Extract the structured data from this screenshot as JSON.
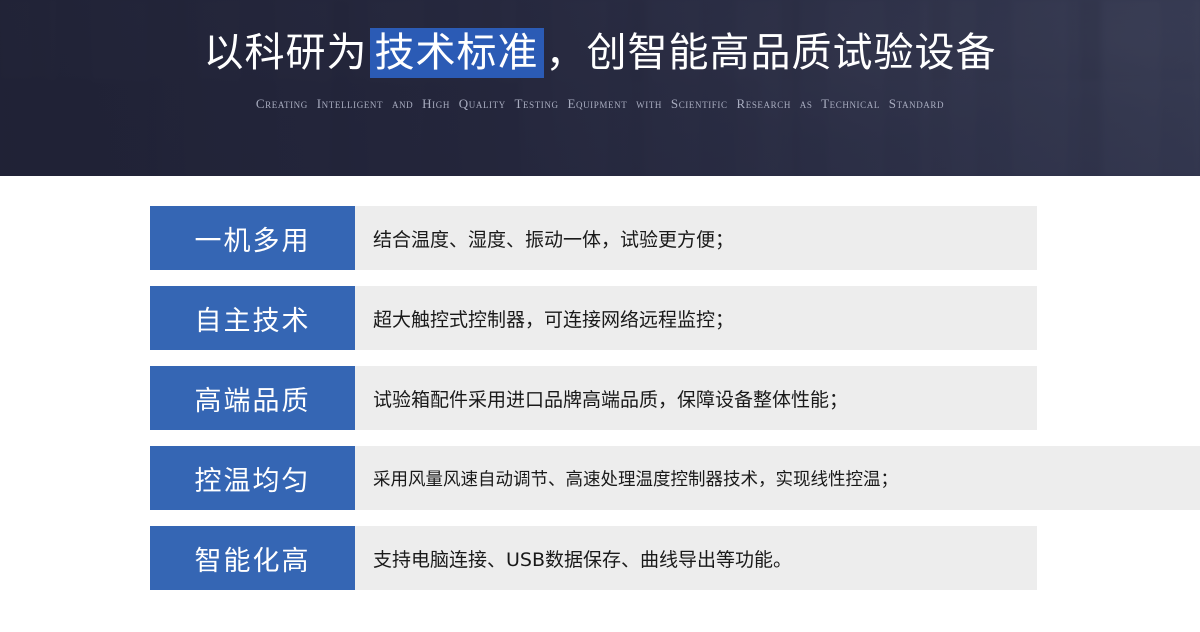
{
  "banner": {
    "title_prefix": "以科研为",
    "title_highlight": "技术标准",
    "title_suffix": "，创智能高品质试验设备",
    "subtitle": "Creating Intelligent and High Quality Testing Equipment with Scientific Research as Technical Standard",
    "highlight_color": "#2b5bb5",
    "overlay_color": "#24263c"
  },
  "features": {
    "label_color": "#3566b4",
    "panel_color": "#ededed",
    "items": [
      {
        "label": "一机多用",
        "description": "结合温度、湿度、振动一体，试验更方便；"
      },
      {
        "label": "自主技术",
        "description": "超大触控式控制器，可连接网络远程监控；"
      },
      {
        "label": "高端品质",
        "description": "试验箱配件采用进口品牌高端品质，保障设备整体性能；"
      },
      {
        "label": "控温均匀",
        "description": "采用风量风速自动调节、高速处理温度控制器技术，实现线性控温；"
      },
      {
        "label": "智能化高",
        "description": "支持电脑连接、USB数据保存、曲线导出等功能。"
      }
    ]
  }
}
